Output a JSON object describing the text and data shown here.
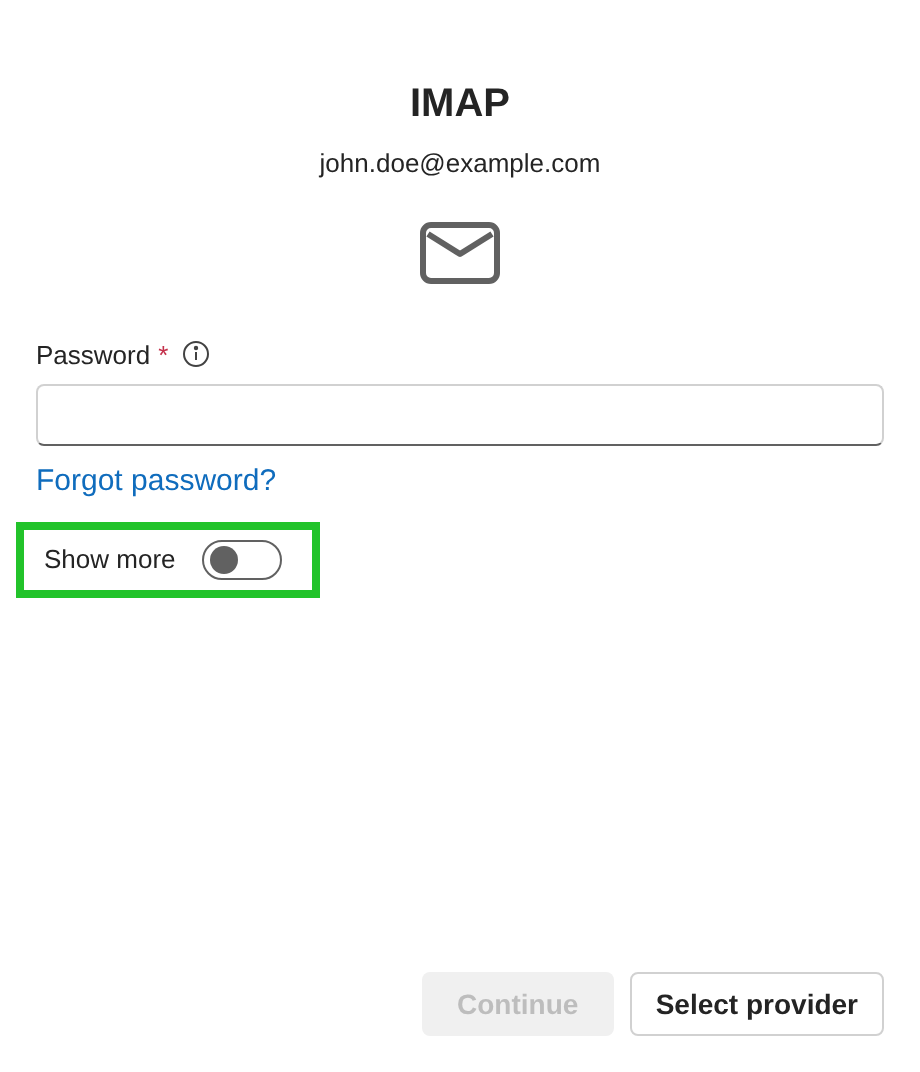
{
  "title": "IMAP",
  "email": "john.doe@example.com",
  "password": {
    "label": "Password",
    "required_mark": "*"
  },
  "forgot_link": "Forgot password?",
  "show_more": {
    "label": "Show more",
    "on": false,
    "highlighted": true
  },
  "buttons": [
    {
      "label": "Continue",
      "disabled": true
    },
    {
      "label": "Select provider",
      "disabled": false
    }
  ]
}
